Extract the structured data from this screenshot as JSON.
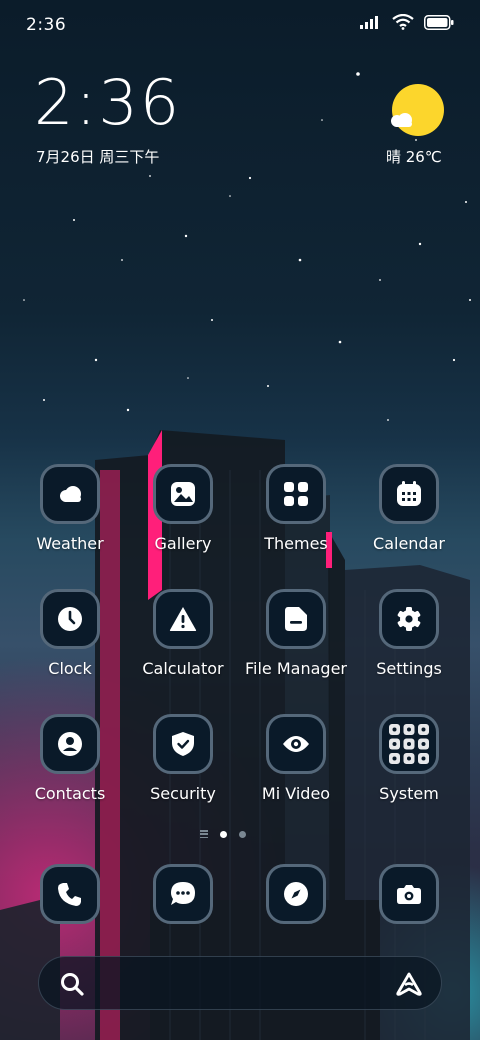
{
  "status_bar": {
    "time": "2:36"
  },
  "clock_widget": {
    "time": "2:36",
    "date": "7月26日 周三下午"
  },
  "weather_widget": {
    "text": "晴 26℃"
  },
  "apps": [
    {
      "label": "Weather",
      "icon": "weather-icon"
    },
    {
      "label": "Gallery",
      "icon": "gallery-icon"
    },
    {
      "label": "Themes",
      "icon": "themes-icon"
    },
    {
      "label": "Calendar",
      "icon": "calendar-icon"
    },
    {
      "label": "Clock",
      "icon": "clock-icon"
    },
    {
      "label": "Calculator",
      "icon": "calculator-icon"
    },
    {
      "label": "File Manager",
      "icon": "file-manager-icon"
    },
    {
      "label": "Settings",
      "icon": "gear-icon"
    },
    {
      "label": "Contacts",
      "icon": "contacts-icon"
    },
    {
      "label": "Security",
      "icon": "shield-icon"
    },
    {
      "label": "Mi Video",
      "icon": "eye-icon"
    },
    {
      "label": "System",
      "icon": "folder-icon"
    }
  ],
  "dock": [
    {
      "icon": "phone-icon"
    },
    {
      "icon": "messages-icon"
    },
    {
      "icon": "compass-icon"
    },
    {
      "icon": "camera-icon"
    }
  ],
  "page_indicator": {
    "pages": 2,
    "current": 1
  },
  "search_bar": {
    "left_icon": "search-icon",
    "right_icon": "assistant-icon"
  },
  "colors": {
    "accent_pink": "#ff1f7a",
    "sun": "#fcd62c",
    "icon_bg": "#0a1a29"
  }
}
